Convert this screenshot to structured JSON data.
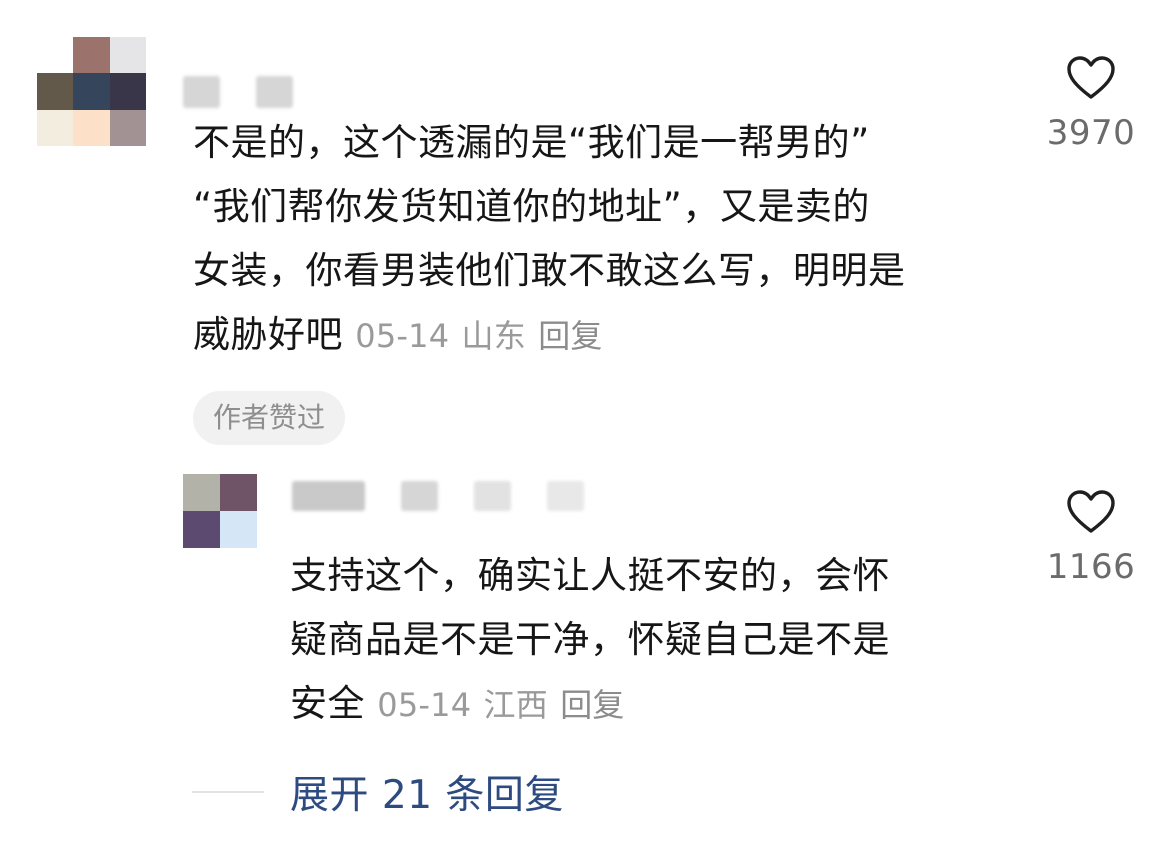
{
  "colors": {
    "text": "#161616",
    "meta": "#9a9a9a",
    "link_blue": "#2d4b80",
    "badge_bg": "#f1f1f1",
    "like_count": "#6b6b6b"
  },
  "comment": {
    "avatar_colors": [
      "#ffffff",
      "#9c726c",
      "#e5e5e7",
      "#63594b",
      "#35465c",
      "#3a364a",
      "#f3ede0",
      "#fde0c8",
      "#a29293"
    ],
    "text_lines": [
      "不是的，这个透漏的是“我们是一帮男的”",
      "“我们帮你发货知道你的地址”，又是卖的",
      "女装，你看男装他们敢不敢这么写，明明是",
      "威胁好吧"
    ],
    "date": "05-14",
    "location": "山东",
    "reply_label": "回复",
    "badge": "作者赞过",
    "like_icon": "heart-outline-icon",
    "likes": "3970"
  },
  "reply": {
    "avatar_colors": [
      "#b3b2a8",
      "#6f5468",
      "#5d4a70",
      "#d5e6f6"
    ],
    "text_lines": [
      "支持这个，确实让人挺不安的，会怀",
      "疑商品是不是干净，怀疑自己是不是",
      "安全"
    ],
    "date": "05-14",
    "location": "江西",
    "reply_label": "回复",
    "like_icon": "heart-outline-icon",
    "likes": "1166"
  },
  "expand": {
    "label": "展开 21 条回复"
  }
}
